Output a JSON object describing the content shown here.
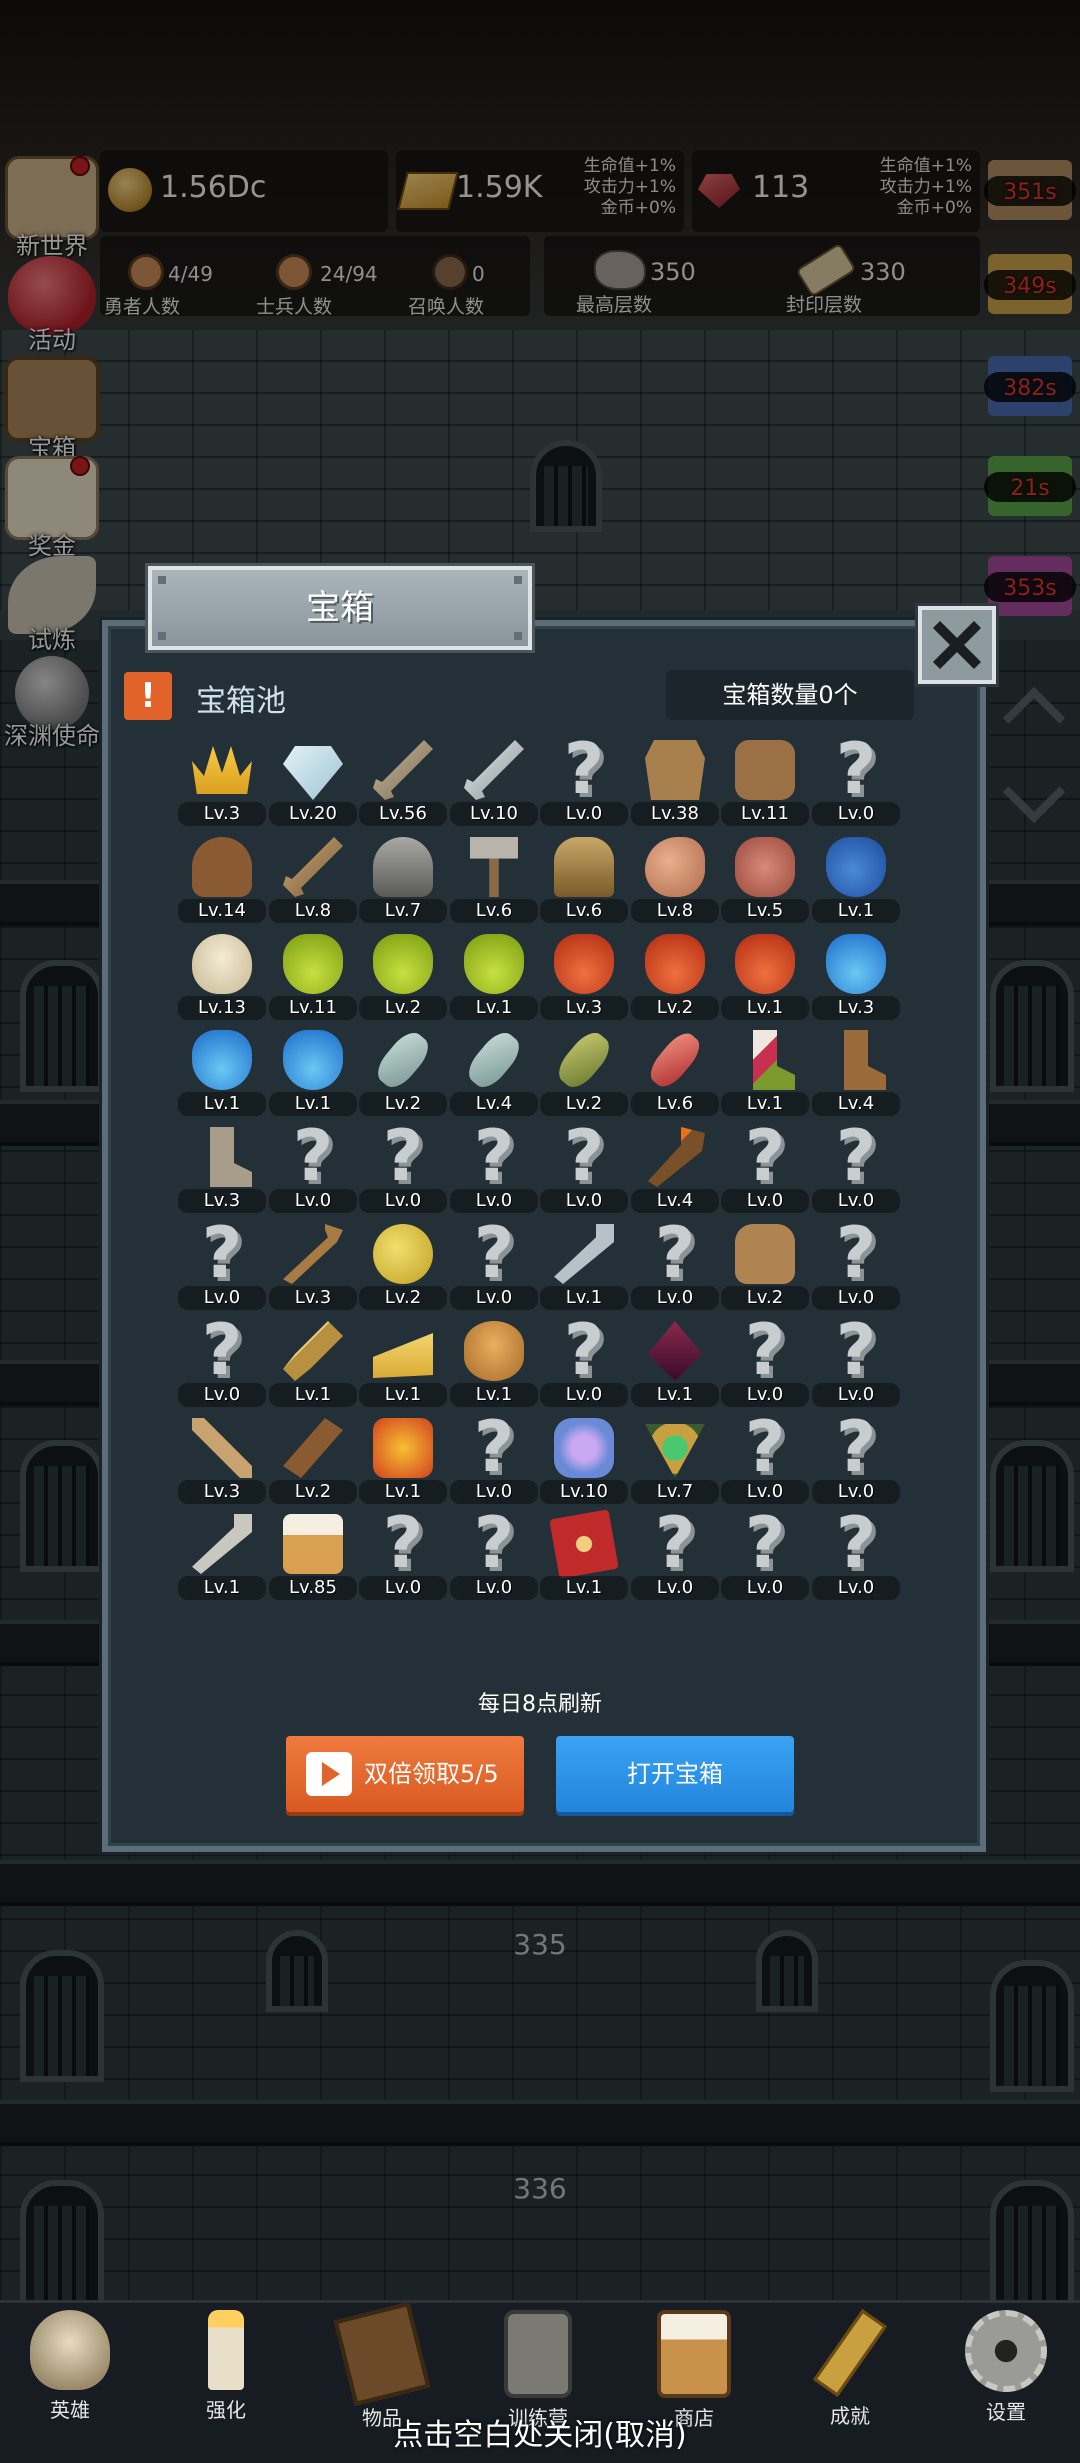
{
  "resources": {
    "gold": "1.56Dc",
    "gold_bar": "1.59K",
    "gem": "113",
    "buff1": [
      "生命值+1%",
      "攻击力+1%",
      "金币+0%"
    ],
    "buff2": [
      "生命值+1%",
      "攻击力+1%",
      "金币+0%"
    ]
  },
  "stats": {
    "heroes": {
      "value": "4/49",
      "label": "勇者人数"
    },
    "soldiers": {
      "value": "24/94",
      "label": "士兵人数"
    },
    "summons": {
      "value": "0",
      "label": "召唤人数"
    },
    "max_floor": {
      "value": "350",
      "label": "最高层数"
    },
    "sealed_floor": {
      "value": "330",
      "label": "封印层数"
    }
  },
  "left_menu": {
    "new_world": "新世界",
    "events": "活动",
    "chest": "宝箱",
    "reward": "奖金",
    "trial": "试炼",
    "abyss": "深渊使命"
  },
  "right_timers": [
    "351s",
    "349s",
    "382s",
    "21s",
    "353s"
  ],
  "dialog": {
    "title": "宝箱",
    "pool_icon": "!",
    "pool_title": "宝箱池",
    "chest_count": "宝箱数量0个",
    "refresh_note": "每日8点刷新",
    "double_claim": "双倍领取5/5",
    "open_chest": "打开宝箱"
  },
  "items": [
    {
      "icon": "crown-icon",
      "level": "Lv.3"
    },
    {
      "icon": "diamond-icon",
      "level": "Lv.20"
    },
    {
      "icon": "sword-icon",
      "level": "Lv.56"
    },
    {
      "icon": "steel-sword-icon",
      "level": "Lv.10"
    },
    {
      "icon": "unknown-icon",
      "level": "Lv.0"
    },
    {
      "icon": "leather-armor-icon",
      "level": "Lv.38"
    },
    {
      "icon": "backpack-icon",
      "level": "Lv.11"
    },
    {
      "icon": "unknown-icon",
      "level": "Lv.0"
    },
    {
      "icon": "leather-helmet-icon",
      "level": "Lv.14"
    },
    {
      "icon": "dagger-icon",
      "level": "Lv.8"
    },
    {
      "icon": "iron-helmet-icon",
      "level": "Lv.7"
    },
    {
      "icon": "hammer-icon",
      "level": "Lv.6"
    },
    {
      "icon": "knight-helmet-icon",
      "level": "Lv.6"
    },
    {
      "icon": "ham-icon",
      "level": "Lv.8"
    },
    {
      "icon": "steak-icon",
      "level": "Lv.5"
    },
    {
      "icon": "blue-sack-icon",
      "level": "Lv.1"
    },
    {
      "icon": "flour-bowl-icon",
      "level": "Lv.13"
    },
    {
      "icon": "green-potion-icon",
      "level": "Lv.11"
    },
    {
      "icon": "green-potion-icon",
      "level": "Lv.2"
    },
    {
      "icon": "green-potion-icon",
      "level": "Lv.1"
    },
    {
      "icon": "red-potion-icon",
      "level": "Lv.3"
    },
    {
      "icon": "red-potion-icon",
      "level": "Lv.2"
    },
    {
      "icon": "red-potion-icon",
      "level": "Lv.1"
    },
    {
      "icon": "blue-potion-icon",
      "level": "Lv.3"
    },
    {
      "icon": "blue-potion-icon",
      "level": "Lv.1"
    },
    {
      "icon": "blue-potion-icon",
      "level": "Lv.1"
    },
    {
      "icon": "vial-icon",
      "level": "Lv.2"
    },
    {
      "icon": "vial-icon",
      "level": "Lv.4"
    },
    {
      "icon": "wine-bottle-icon",
      "level": "Lv.2"
    },
    {
      "icon": "red-vial-icon",
      "level": "Lv.6"
    },
    {
      "icon": "winged-boot-icon",
      "level": "Lv.1"
    },
    {
      "icon": "leather-boot-icon",
      "level": "Lv.4"
    },
    {
      "icon": "iron-boot-icon",
      "level": "Lv.3"
    },
    {
      "icon": "unknown-icon",
      "level": "Lv.0"
    },
    {
      "icon": "unknown-icon",
      "level": "Lv.0"
    },
    {
      "icon": "unknown-icon",
      "level": "Lv.0"
    },
    {
      "icon": "unknown-icon",
      "level": "Lv.0"
    },
    {
      "icon": "torch-icon",
      "level": "Lv.4"
    },
    {
      "icon": "unknown-icon",
      "level": "Lv.0"
    },
    {
      "icon": "unknown-icon",
      "level": "Lv.0"
    },
    {
      "icon": "unknown-icon",
      "level": "Lv.0"
    },
    {
      "icon": "wooden-staff-icon",
      "level": "Lv.3"
    },
    {
      "icon": "lemon-icon",
      "level": "Lv.2"
    },
    {
      "icon": "unknown-icon",
      "level": "Lv.0"
    },
    {
      "icon": "magic-wand-icon",
      "level": "Lv.1"
    },
    {
      "icon": "unknown-icon",
      "level": "Lv.0"
    },
    {
      "icon": "satchel-icon",
      "level": "Lv.2"
    },
    {
      "icon": "unknown-icon",
      "level": "Lv.0"
    },
    {
      "icon": "unknown-icon",
      "level": "Lv.0"
    },
    {
      "icon": "broom-icon",
      "level": "Lv.1"
    },
    {
      "icon": "cheese-icon",
      "level": "Lv.1"
    },
    {
      "icon": "pie-icon",
      "level": "Lv.1"
    },
    {
      "icon": "unknown-icon",
      "level": "Lv.0"
    },
    {
      "icon": "crystal-icon",
      "level": "Lv.1"
    },
    {
      "icon": "unknown-icon",
      "level": "Lv.0"
    },
    {
      "icon": "unknown-icon",
      "level": "Lv.0"
    },
    {
      "icon": "bow-icon",
      "level": "Lv.3"
    },
    {
      "icon": "quiver-icon",
      "level": "Lv.2"
    },
    {
      "icon": "fire-scroll-icon",
      "level": "Lv.1"
    },
    {
      "icon": "unknown-icon",
      "level": "Lv.0"
    },
    {
      "icon": "chain-icon",
      "level": "Lv.10"
    },
    {
      "icon": "emerald-amulet-icon",
      "level": "Lv.7"
    },
    {
      "icon": "unknown-icon",
      "level": "Lv.0"
    },
    {
      "icon": "unknown-icon",
      "level": "Lv.0"
    },
    {
      "icon": "green-scepter-icon",
      "level": "Lv.1"
    },
    {
      "icon": "beer-mug-icon",
      "level": "Lv.85"
    },
    {
      "icon": "unknown-icon",
      "level": "Lv.0"
    },
    {
      "icon": "unknown-icon",
      "level": "Lv.0"
    },
    {
      "icon": "spell-book-icon",
      "level": "Lv.1"
    },
    {
      "icon": "unknown-icon",
      "level": "Lv.0"
    },
    {
      "icon": "unknown-icon",
      "level": "Lv.0"
    },
    {
      "icon": "unknown-icon",
      "level": "Lv.0"
    }
  ],
  "background_floors": [
    "335",
    "336"
  ],
  "bottom_nav": [
    "英雄",
    "强化",
    "物品",
    "训练营",
    "商店",
    "成就",
    "设置"
  ],
  "close_hint": "点击空白处关闭(取消)"
}
